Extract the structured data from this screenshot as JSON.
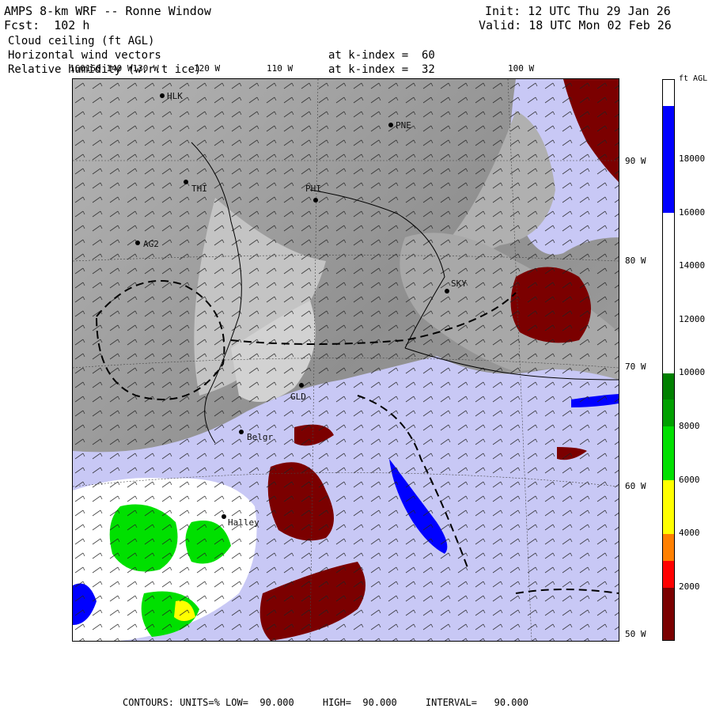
{
  "header": {
    "title": "AMPS 8-km WRF -- Ronne Window",
    "forecast": "Fcst:  102 h",
    "init": "Init: 12 UTC Thu 29 Jan 26",
    "valid": "Valid: 18 UTC Mon 02 Feb 26",
    "field1": "Cloud ceiling (ft AGL)",
    "field2": "Horizontal wind vectors",
    "field2_level": "at k-index =  60",
    "field3": "Relative humidity (w.r.t ice)",
    "field3_level": "at k-index =  32"
  },
  "longitude_labels": [
    "160150 140 W130 W",
    "120 W",
    "110 W",
    "100 W"
  ],
  "latitude_labels": [
    "90 W",
    "80 W",
    "70 W",
    "60 W",
    "50 W"
  ],
  "stations": [
    "HLK",
    "PNE",
    "THI",
    "PHI",
    "AG2",
    "SKY",
    "GLD",
    "Belgr",
    "Halley"
  ],
  "colorbar": {
    "units": "ft AGL",
    "labels": [
      "18000",
      "16000",
      "14000",
      "12000",
      "10000",
      "8000",
      "6000",
      "4000",
      "2000"
    ],
    "colors": {
      "ceiling_0_1000": "#7b0000",
      "ceiling_1000_2000": "#ff0000",
      "ceiling_2000_3000": "#ff8000",
      "ceiling_3000_5000": "#ffff00",
      "ceiling_5000_9000": "#00e000",
      "ceiling_9000_10000": "#008000",
      "ceiling_high": "#ffffff",
      "ceiling_top": "#0000ff",
      "ocean_rh": "#c8c8f5",
      "terrain": "#9a9a9a"
    }
  },
  "footer": "CONTOURS: UNITS=% LOW=  90.000     HIGH=  90.000     INTERVAL=   90.000"
}
